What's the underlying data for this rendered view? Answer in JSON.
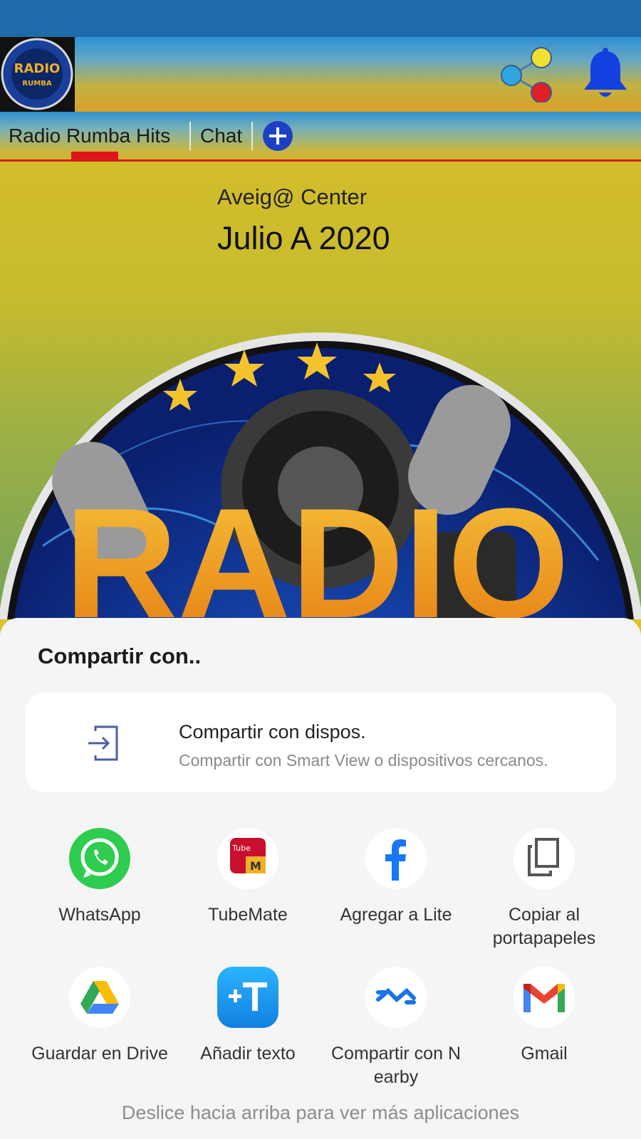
{
  "header": {
    "logo_text": "RADIO RUMBA HITS"
  },
  "tabs": {
    "items": [
      {
        "label": "Radio Rumba Hits"
      },
      {
        "label": "Chat"
      }
    ]
  },
  "now_playing": {
    "artist": "Aveig@ Center",
    "title": "Julio A 2020",
    "art_text": "RADIO"
  },
  "share_sheet": {
    "title": "Compartir con..",
    "device_share": {
      "title": "Compartir con dispos.",
      "subtitle": "Compartir con Smart View o dispositivos cercanos."
    },
    "apps": [
      {
        "label": "WhatsApp",
        "icon": "whatsapp-icon"
      },
      {
        "label": "TubeMate",
        "icon": "tubemate-icon"
      },
      {
        "label": "Agregar a Lite",
        "icon": "facebook-lite-icon"
      },
      {
        "label": "Copiar al portapapeles",
        "icon": "copy-icon"
      },
      {
        "label": "Guardar en Drive",
        "icon": "google-drive-icon"
      },
      {
        "label": "Añadir texto",
        "icon": "add-text-icon"
      },
      {
        "label": "Compartir con N earby",
        "icon": "nearby-share-icon"
      },
      {
        "label": "Gmail",
        "icon": "gmail-icon"
      }
    ],
    "hint": "Deslice hacia arriba para ver más aplicaciones"
  },
  "colors": {
    "accent_red": "#e0141a",
    "tab_plus_blue": "#1e3fc4",
    "bell_blue": "#1540e0",
    "sheet_bg": "#f5f5f5"
  }
}
